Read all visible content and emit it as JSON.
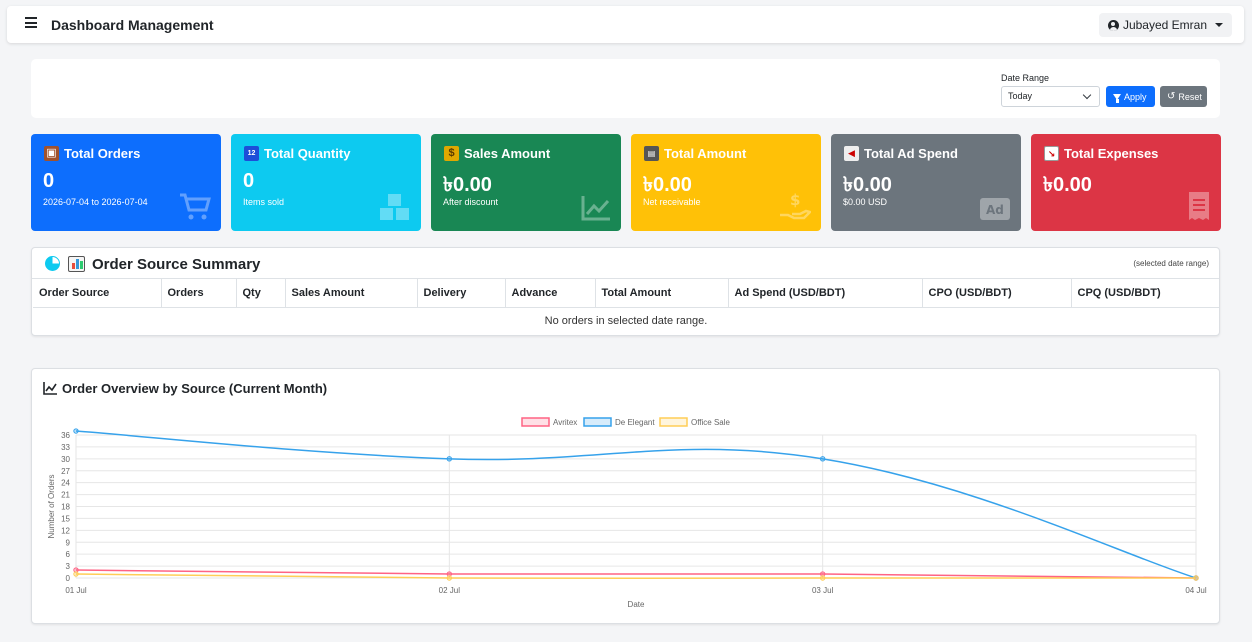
{
  "app": {
    "title": "Dashboard Management",
    "user": "Jubayed Emran"
  },
  "filter": {
    "label": "Date Range",
    "selected": "Today",
    "apply_label": "Apply",
    "reset_label": "Reset"
  },
  "stats": [
    {
      "title": "Total Orders",
      "icon": "package-icon",
      "value": "0",
      "sub": "2026-07-04 to 2026-07-04",
      "bg_icon": "cart-icon",
      "color": "#0d6efd"
    },
    {
      "title": "Total Quantity",
      "icon": "numbers-icon",
      "value": "0",
      "sub": "Items sold",
      "bg_icon": "boxes-icon",
      "color": "#0dcaf0"
    },
    {
      "title": "Sales Amount",
      "icon": "money-bag-icon",
      "value": "৳0.00",
      "sub": "After discount",
      "bg_icon": "trend-chart-icon",
      "color": "#198754"
    },
    {
      "title": "Total Amount",
      "icon": "cash-register-icon",
      "value": "৳0.00",
      "sub": "Net receivable",
      "bg_icon": "hand-dollar-icon",
      "color": "#ffc107"
    },
    {
      "title": "Total Ad Spend",
      "icon": "megaphone-icon",
      "value": "৳0.00",
      "sub": "$0.00 USD",
      "bg_icon": "ad-icon",
      "color": "#6c757d"
    },
    {
      "title": "Total Expenses",
      "icon": "chart-down-icon",
      "value": "৳0.00",
      "sub": "",
      "bg_icon": "receipt-icon",
      "color": "#dc3545"
    }
  ],
  "summary": {
    "title": "Order Source Summary",
    "note": "(selected date range)",
    "columns": [
      "Order Source",
      "Orders",
      "Qty",
      "Sales Amount",
      "Delivery",
      "Advance",
      "Total Amount",
      "Ad Spend (USD/BDT)",
      "CPO (USD/BDT)",
      "CPQ (USD/BDT)"
    ],
    "empty": "No orders in selected date range."
  },
  "chart_data": {
    "type": "line",
    "title": "Order Overview by Source (Current Month)",
    "xlabel": "Date",
    "ylabel": "Number of Orders",
    "categories": [
      "01 Jul",
      "02 Jul",
      "03 Jul",
      "04 Jul"
    ],
    "ylim": [
      0,
      36
    ],
    "yticks": [
      0,
      3,
      6,
      9,
      12,
      15,
      18,
      21,
      24,
      27,
      30,
      33,
      36
    ],
    "legend_position": "top",
    "grid": true,
    "series": [
      {
        "name": "Avritex",
        "color": "#ff6384",
        "values": [
          2,
          1,
          1,
          0
        ]
      },
      {
        "name": "De Elegant",
        "color": "#36a2eb",
        "values": [
          37,
          30,
          30,
          0
        ]
      },
      {
        "name": "Office Sale",
        "color": "#ffcd56",
        "values": [
          1,
          0,
          0,
          0
        ]
      }
    ]
  }
}
